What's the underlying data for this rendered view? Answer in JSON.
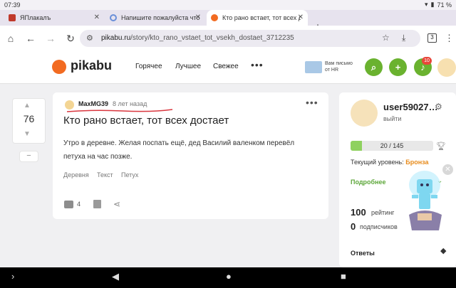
{
  "status_bar": {
    "time": "07:39",
    "battery": "71 %"
  },
  "tabs": [
    {
      "title": "ЯПлакалъ"
    },
    {
      "title": "Напишите пожалуйста что"
    },
    {
      "title": "Кто рано встает, тот всех д"
    }
  ],
  "address_bar": {
    "url_host": "pikabu.ru",
    "url_path": "/story/kto_rano_vstaet_tot_vsekh_dostaet_3712235",
    "tab_count": "3"
  },
  "site_header": {
    "logo": "pikabu",
    "nav": [
      "Горячее",
      "Лучшее",
      "Свежее"
    ],
    "mail_text_line1": "Вам письмо",
    "mail_text_line2": "от HR",
    "notifications_count": "10"
  },
  "story": {
    "rating": "76",
    "author": "MaxMG39",
    "time": "8 лет назад",
    "title": "Кто рано встает, тот всех достает",
    "text": "Утро в деревне. Желая поспать ещё, дед Василий валенком перевёл петуха на час позже.",
    "tags": [
      "Деревня",
      "Текст",
      "Петух"
    ],
    "comments_count": "4"
  },
  "user_panel": {
    "username": "user59027…",
    "logout": "выйти",
    "progress_text": "20 / 145",
    "progress_fraction": 0.138,
    "level_label": "Текущий уровень: ",
    "level_value": "Бронза",
    "more_label": "Подробнее",
    "rating_value": "100",
    "rating_label": "рейтинг",
    "subscribers_value": "0",
    "subscribers_label": "подписчиков",
    "answers_label": "Ответы"
  },
  "colors": {
    "brand_orange": "#f26b21",
    "accent_green": "#6ab22f",
    "level_bronze": "#e78b1c",
    "badge_red": "#e8463a"
  }
}
